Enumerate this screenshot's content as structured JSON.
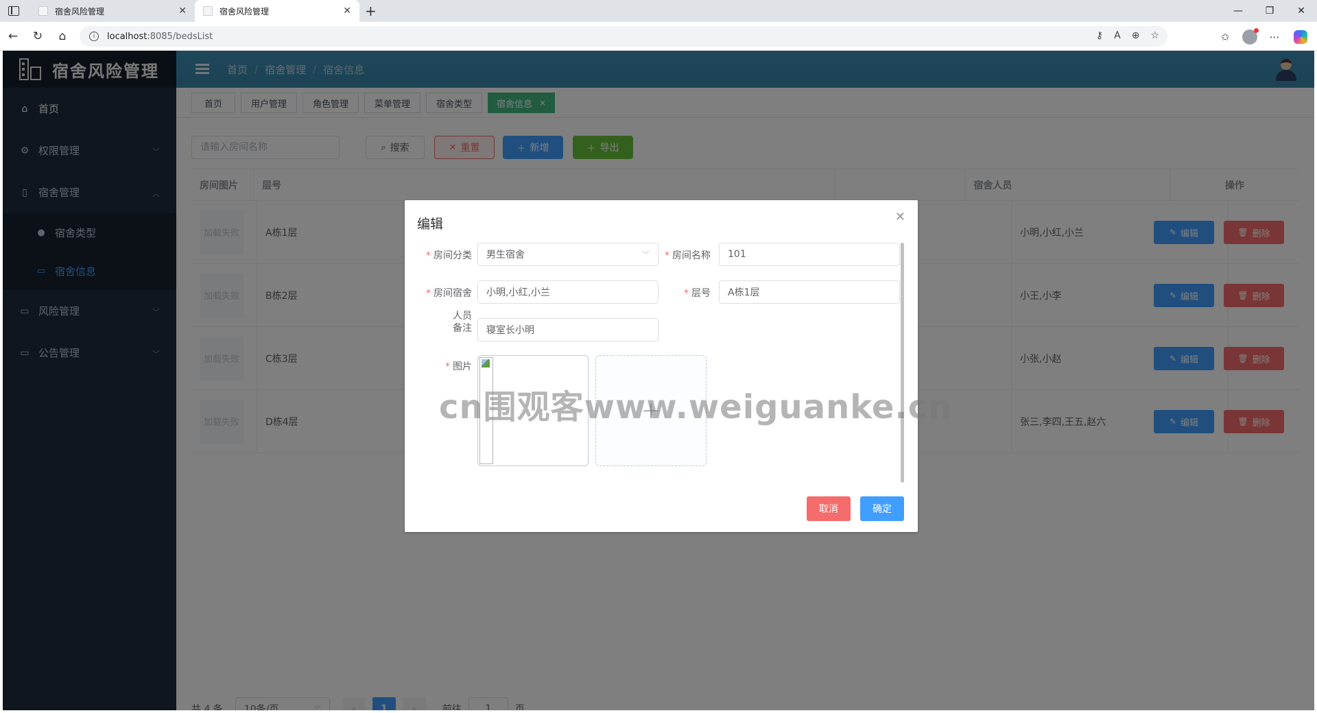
{
  "browser": {
    "tabs": [
      {
        "title": "宿舍风险管理"
      },
      {
        "title": "宿舍风险管理"
      }
    ],
    "url_host": "localhost",
    "url_rest": ":8085/bedsList"
  },
  "sidebar": {
    "logo": "宿舍风险管理",
    "items": [
      {
        "label": "首页",
        "icon": "home-icon"
      },
      {
        "label": "权限管理",
        "icon": "gear-icon"
      },
      {
        "label": "宿舍管理",
        "icon": "document-icon"
      },
      {
        "label": "风险管理",
        "icon": "folder-icon"
      },
      {
        "label": "公告管理",
        "icon": "folder-icon"
      }
    ],
    "sub_items": [
      {
        "label": "宿舍类型",
        "icon": "user-icon"
      },
      {
        "label": "宿舍信息",
        "icon": "folder-icon"
      }
    ]
  },
  "header": {
    "breadcrumb": [
      "首页",
      "宿舍管理",
      "宿舍信息"
    ]
  },
  "tags": [
    {
      "label": "首页"
    },
    {
      "label": "用户管理"
    },
    {
      "label": "角色管理"
    },
    {
      "label": "菜单管理"
    },
    {
      "label": "宿舍类型"
    },
    {
      "label": "宿舍信息",
      "close": "×"
    }
  ],
  "toolbar": {
    "search_placeholder": "请输入房间名称",
    "search_label": "搜索",
    "reset_label": "重置",
    "add_label": "新增",
    "export_label": "导出"
  },
  "table": {
    "headers": [
      "房间图片",
      "层号",
      "宿舍人员",
      "操作"
    ],
    "rows": [
      {
        "img": "加载失败",
        "floor": "A栋1层",
        "people": "小明,小红,小兰"
      },
      {
        "img": "加载失败",
        "floor": "B栋2层",
        "people": "小王,小李"
      },
      {
        "img": "加载失败",
        "floor": "C栋3层",
        "people": "小张,小赵"
      },
      {
        "img": "加载失败",
        "floor": "D栋4层",
        "people": "张三,李四,王五,赵六"
      }
    ],
    "edit_label": "编辑",
    "delete_label": "删除"
  },
  "pagination": {
    "total": "共 4 条",
    "page_size": "10条/页",
    "current_page": "1",
    "goto_label": "前往",
    "goto_value": "1",
    "page_suffix": "页"
  },
  "dialog": {
    "title": "编辑",
    "fields": {
      "room_type_label": "房间分类",
      "room_type_value": "男生宿舍",
      "room_name_label": "房间名称",
      "room_name_value": "101",
      "dorm_people_label": "房间宿舍",
      "dorm_people_value": "小明,小红,小兰",
      "floor_label": "层号",
      "floor_value": "A栋1层",
      "note_label_1": "人员",
      "note_label_2": "备注",
      "note_value": "寝室长小明",
      "image_label": "图片"
    },
    "required_mark": "*",
    "cancel_label": "取消",
    "ok_label": "确定"
  },
  "watermark": "cn围观客www.weiguanke.cn"
}
